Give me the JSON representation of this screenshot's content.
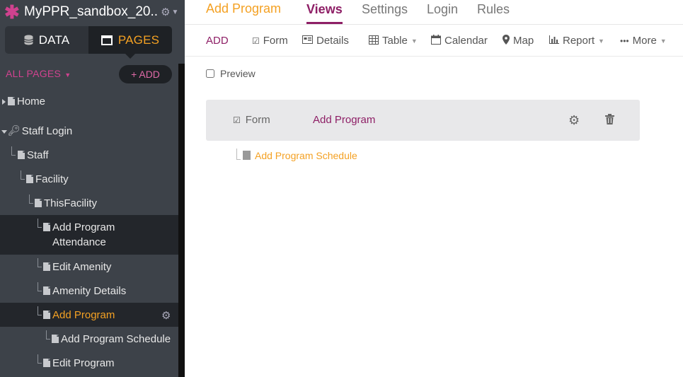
{
  "sidebar": {
    "app_title": "MyPPR_sandbox_20..",
    "modes": {
      "data_label": "DATA",
      "pages_label": "PAGES"
    },
    "all_pages_label": "ALL PAGES",
    "add_label": "+ ADD",
    "tree": [
      {
        "label": "Home"
      },
      {
        "label": "Staff Login"
      },
      {
        "label": "Staff"
      },
      {
        "label": "Facility"
      },
      {
        "label": "ThisFacility"
      },
      {
        "label": "Add Program",
        "label_line2": "Attendance"
      },
      {
        "label": "Edit Amenity"
      },
      {
        "label": "Amenity Details"
      },
      {
        "label": "Add Program"
      },
      {
        "label": "Add Program Schedule"
      },
      {
        "label": "Edit Program"
      }
    ]
  },
  "header": {
    "page_name": "Add Program",
    "tabs": [
      {
        "label": "Views"
      },
      {
        "label": "Settings"
      },
      {
        "label": "Login"
      },
      {
        "label": "Rules"
      }
    ]
  },
  "toolbar": {
    "add_label": "ADD",
    "items": [
      {
        "label": "Form"
      },
      {
        "label": "Details"
      },
      {
        "label": "Table"
      },
      {
        "label": "Calendar"
      },
      {
        "label": "Map"
      },
      {
        "label": "Report"
      },
      {
        "label": "More"
      }
    ]
  },
  "preview_label": "Preview",
  "view_card": {
    "type_label": "Form",
    "title": "Add Program"
  },
  "child_page": {
    "label": "Add Program Schedule"
  }
}
